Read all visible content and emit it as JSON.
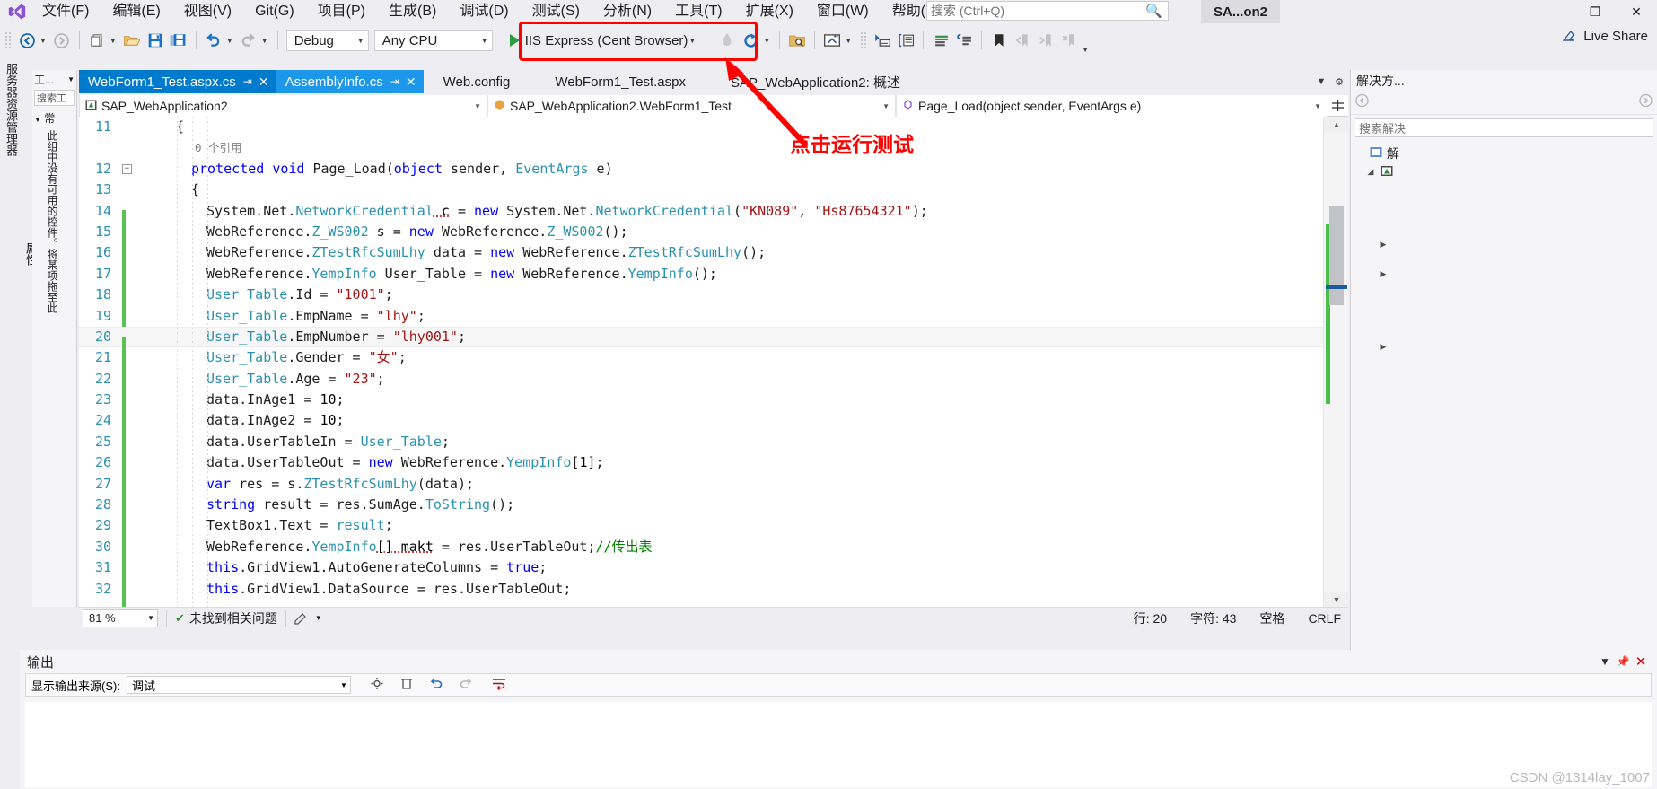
{
  "window": {
    "title": "SA...on2",
    "minimize": "—",
    "restore": "❐",
    "close": "✕"
  },
  "menu": {
    "items": [
      {
        "label": "文件(F)"
      },
      {
        "label": "编辑(E)"
      },
      {
        "label": "视图(V)"
      },
      {
        "label": "Git(G)"
      },
      {
        "label": "项目(P)"
      },
      {
        "label": "生成(B)"
      },
      {
        "label": "调试(D)"
      },
      {
        "label": "测试(S)"
      },
      {
        "label": "分析(N)"
      },
      {
        "label": "工具(T)"
      },
      {
        "label": "扩展(X)"
      },
      {
        "label": "窗口(W)"
      },
      {
        "label": "帮助(H)"
      }
    ],
    "search_placeholder": "搜索 (Ctrl+Q)"
  },
  "toolbar": {
    "back_tooltip": "后退",
    "forward_tooltip": "前进",
    "new_item": "新建项",
    "open_file": "打开文件",
    "save": "保存",
    "save_all": "全部保存",
    "undo": "撤消",
    "redo": "恢复",
    "configuration": "Debug",
    "platform": "Any CPU",
    "run_target": "IIS Express (Cent Browser)",
    "live_share": "Live Share"
  },
  "toolbox": {
    "title": "工...",
    "search_placeholder": "搜索工",
    "group": "常",
    "message": "此组中没有可用的控件。将某项拖至此"
  },
  "editor": {
    "tabs": [
      {
        "label": "WebForm1_Test.aspx.cs",
        "state": "active",
        "pinned": true,
        "closable": true
      },
      {
        "label": "AssemblyInfo.cs",
        "state": "preview",
        "pinned": true,
        "closable": true
      },
      {
        "label": "Web.config",
        "state": "inactive",
        "pinned": false,
        "closable": false
      },
      {
        "label": "WebForm1_Test.aspx",
        "state": "inactive",
        "pinned": false,
        "closable": false
      },
      {
        "label": "SAP_WebApplication2: 概述",
        "state": "inactive",
        "pinned": false,
        "closable": false
      }
    ],
    "nav": {
      "project": "SAP_WebApplication2",
      "type": "SAP_WebApplication2.WebForm1_Test",
      "member": "Page_Load(object sender, EventArgs e)"
    },
    "lines": [
      {
        "n": "11",
        "indent": 2,
        "tokens": [
          {
            "t": "{",
            "c": "pl"
          }
        ]
      },
      {
        "n": "",
        "indent": 0,
        "ref": "0 个引用"
      },
      {
        "n": "12",
        "indent": 3,
        "collapse": true,
        "tokens": [
          {
            "t": "protected ",
            "c": "kw"
          },
          {
            "t": "void ",
            "c": "kw"
          },
          {
            "t": "Page_Load(",
            "c": "pl"
          },
          {
            "t": "object ",
            "c": "kw"
          },
          {
            "t": "sender, ",
            "c": "pl"
          },
          {
            "t": "EventArgs",
            "c": "ty"
          },
          {
            "t": " e)",
            "c": "pl"
          }
        ]
      },
      {
        "n": "13",
        "indent": 3,
        "tokens": [
          {
            "t": "{",
            "c": "pl"
          }
        ]
      },
      {
        "n": "14",
        "indent": 4,
        "change": true,
        "tokens": [
          {
            "t": "System.Net.",
            "c": "pl"
          },
          {
            "t": "NetworkCredential",
            "c": "ty"
          },
          {
            "t": " c",
            "c": "sq"
          },
          {
            "t": " = ",
            "c": "pl"
          },
          {
            "t": "new ",
            "c": "kw"
          },
          {
            "t": "System.Net.",
            "c": "pl"
          },
          {
            "t": "NetworkCredential",
            "c": "ty"
          },
          {
            "t": "(",
            "c": "pl"
          },
          {
            "t": "\"KN089\"",
            "c": "st"
          },
          {
            "t": ", ",
            "c": "pl"
          },
          {
            "t": "\"Hs87654321\"",
            "c": "st"
          },
          {
            "t": ");",
            "c": "pl"
          }
        ]
      },
      {
        "n": "15",
        "indent": 4,
        "change": true,
        "tokens": [
          {
            "t": "WebReference.",
            "c": "pl"
          },
          {
            "t": "Z_WS002",
            "c": "ty"
          },
          {
            "t": " s = ",
            "c": "pl"
          },
          {
            "t": "new ",
            "c": "kw"
          },
          {
            "t": "WebReference.",
            "c": "pl"
          },
          {
            "t": "Z_WS002",
            "c": "ty"
          },
          {
            "t": "();",
            "c": "pl"
          }
        ]
      },
      {
        "n": "16",
        "indent": 4,
        "change": true,
        "tokens": [
          {
            "t": "WebReference.",
            "c": "pl"
          },
          {
            "t": "ZTestRfcSumLhy",
            "c": "ty"
          },
          {
            "t": " data = ",
            "c": "pl"
          },
          {
            "t": "new ",
            "c": "kw"
          },
          {
            "t": "WebReference.",
            "c": "pl"
          },
          {
            "t": "ZTestRfcSumLhy",
            "c": "ty"
          },
          {
            "t": "();",
            "c": "pl"
          }
        ]
      },
      {
        "n": "17",
        "indent": 4,
        "change": true,
        "tokens": [
          {
            "t": "WebReference.",
            "c": "pl"
          },
          {
            "t": "YempInfo",
            "c": "ty"
          },
          {
            "t": " User_Table = ",
            "c": "pl"
          },
          {
            "t": "new ",
            "c": "kw"
          },
          {
            "t": "WebReference.",
            "c": "pl"
          },
          {
            "t": "YempInfo",
            "c": "ty"
          },
          {
            "t": "();",
            "c": "pl"
          }
        ]
      },
      {
        "n": "18",
        "indent": 4,
        "change": true,
        "tokens": [
          {
            "t": "User_Table",
            "c": "ty"
          },
          {
            "t": ".Id = ",
            "c": "pl"
          },
          {
            "t": "\"1001\"",
            "c": "st"
          },
          {
            "t": ";",
            "c": "pl"
          }
        ]
      },
      {
        "n": "19",
        "indent": 4,
        "change": true,
        "tokens": [
          {
            "t": "User_Table",
            "c": "ty"
          },
          {
            "t": ".EmpName = ",
            "c": "pl"
          },
          {
            "t": "\"lhy\"",
            "c": "st"
          },
          {
            "t": ";",
            "c": "pl"
          }
        ]
      },
      {
        "n": "20",
        "indent": 4,
        "change": true,
        "current": true,
        "tokens": [
          {
            "t": "User_Table",
            "c": "ty"
          },
          {
            "t": ".EmpNumber = ",
            "c": "pl"
          },
          {
            "t": "\"lhy001\"",
            "c": "st"
          },
          {
            "t": ";",
            "c": "pl"
          }
        ]
      },
      {
        "n": "21",
        "indent": 4,
        "change": true,
        "tokens": [
          {
            "t": "User_Table",
            "c": "ty"
          },
          {
            "t": ".Gender = ",
            "c": "pl"
          },
          {
            "t": "\"女\"",
            "c": "st"
          },
          {
            "t": ";",
            "c": "pl"
          }
        ]
      },
      {
        "n": "22",
        "indent": 4,
        "change": true,
        "tokens": [
          {
            "t": "User_Table",
            "c": "ty"
          },
          {
            "t": ".Age = ",
            "c": "pl"
          },
          {
            "t": "\"23\"",
            "c": "st"
          },
          {
            "t": ";",
            "c": "pl"
          }
        ]
      },
      {
        "n": "23",
        "indent": 4,
        "change": true,
        "tokens": [
          {
            "t": "data.InAge1 = ",
            "c": "pl"
          },
          {
            "t": "10",
            "c": "num"
          },
          {
            "t": ";",
            "c": "pl"
          }
        ]
      },
      {
        "n": "24",
        "indent": 4,
        "change": true,
        "tokens": [
          {
            "t": "data.InAge2 = ",
            "c": "pl"
          },
          {
            "t": "10",
            "c": "num"
          },
          {
            "t": ";",
            "c": "pl"
          }
        ]
      },
      {
        "n": "25",
        "indent": 4,
        "change": true,
        "tokens": [
          {
            "t": "data.UserTableIn = ",
            "c": "pl"
          },
          {
            "t": "User_Table",
            "c": "ty"
          },
          {
            "t": ";",
            "c": "pl"
          }
        ]
      },
      {
        "n": "26",
        "indent": 4,
        "change": true,
        "tokens": [
          {
            "t": "data.UserTableOut = ",
            "c": "pl"
          },
          {
            "t": "new ",
            "c": "kw"
          },
          {
            "t": "WebReference.",
            "c": "pl"
          },
          {
            "t": "YempInfo",
            "c": "ty"
          },
          {
            "t": "[",
            "c": "pl"
          },
          {
            "t": "1",
            "c": "num"
          },
          {
            "t": "];",
            "c": "pl"
          }
        ]
      },
      {
        "n": "27",
        "indent": 4,
        "change": true,
        "tokens": [
          {
            "t": "var ",
            "c": "kw"
          },
          {
            "t": "res = s.",
            "c": "pl"
          },
          {
            "t": "ZTestRfcSumLhy",
            "c": "ty"
          },
          {
            "t": "(data);",
            "c": "pl"
          }
        ]
      },
      {
        "n": "28",
        "indent": 4,
        "change": true,
        "tokens": [
          {
            "t": "string ",
            "c": "kw"
          },
          {
            "t": "result = res.SumAge.",
            "c": "pl"
          },
          {
            "t": "ToString",
            "c": "ty"
          },
          {
            "t": "();",
            "c": "pl"
          }
        ]
      },
      {
        "n": "29",
        "indent": 4,
        "change": true,
        "tokens": [
          {
            "t": "TextBox1.Text = ",
            "c": "pl"
          },
          {
            "t": "result",
            "c": "ty"
          },
          {
            "t": ";",
            "c": "pl"
          }
        ]
      },
      {
        "n": "30",
        "indent": 4,
        "change": true,
        "tokens": [
          {
            "t": "WebReference.",
            "c": "pl"
          },
          {
            "t": "YempInfo",
            "c": "ty"
          },
          {
            "t": "[] makt",
            "c": "sq"
          },
          {
            "t": " = res.UserTableOut;",
            "c": "pl"
          },
          {
            "t": "//传出表",
            "c": "cm"
          }
        ]
      },
      {
        "n": "31",
        "indent": 4,
        "change": true,
        "tokens": [
          {
            "t": "this",
            "c": "kw"
          },
          {
            "t": ".GridView1.AutoGenerateColumns = ",
            "c": "pl"
          },
          {
            "t": "true",
            "c": "kw"
          },
          {
            "t": ";",
            "c": "pl"
          }
        ]
      },
      {
        "n": "32",
        "indent": 4,
        "change": true,
        "tokens": [
          {
            "t": "this",
            "c": "kw"
          },
          {
            "t": ".GridView1.DataSource = res.UserTableOut;",
            "c": "pl"
          }
        ]
      }
    ],
    "status": {
      "zoom": "81 %",
      "issues": "未找到相关问题",
      "line_label": "行: 20",
      "char_label": "字符: 43",
      "spaces": "空格",
      "eol": "CRLF"
    }
  },
  "right_panel": {
    "title": "解决方...",
    "search_placeholder": "搜索解决",
    "nodes": [
      {
        "label": "解",
        "icon": "solution-icon",
        "expanded": false
      },
      {
        "label": "",
        "icon": "project-icon",
        "expanded": true
      },
      {
        "label": "",
        "icon": "folder-icon",
        "expanded": false
      },
      {
        "label": "",
        "icon": "folder-icon",
        "expanded": false
      },
      {
        "label": "",
        "icon": "folder-icon",
        "expanded": false
      }
    ]
  },
  "output_panel": {
    "title": "输出",
    "source_label": "显示输出来源(S):",
    "source_value": "调试"
  },
  "annotations": {
    "run_button_note": "点击运行测试",
    "highlight_color": "#ff0000"
  },
  "watermark": "CSDN @1314lay_1007",
  "left_dock": {
    "label_1": "服务器资源管理器",
    "label_2": "属性"
  }
}
